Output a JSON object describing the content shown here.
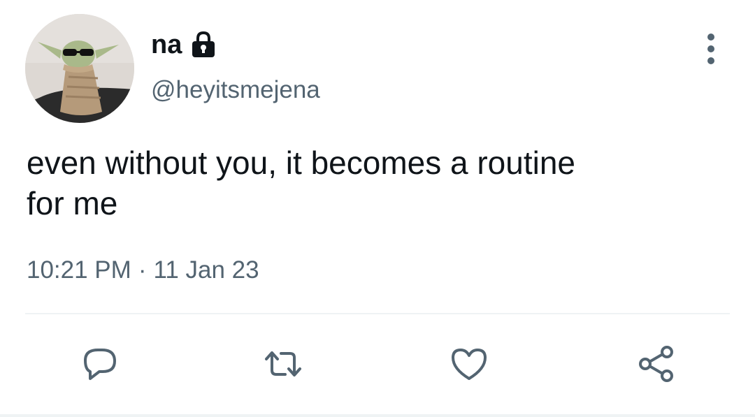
{
  "tweet": {
    "author": {
      "display_name": "na",
      "handle": "@heyitsmejena",
      "protected_icon": "lock-icon",
      "avatar_icon": "avatar-image"
    },
    "text": "even without you, it becomes a routine\nfor me",
    "time": "10:21 PM",
    "separator": "·",
    "date": "11 Jan 23"
  },
  "actions": [
    {
      "name": "reply",
      "icon": "reply-icon"
    },
    {
      "name": "retweet",
      "icon": "retweet-icon"
    },
    {
      "name": "like",
      "icon": "heart-icon"
    },
    {
      "name": "share",
      "icon": "share-icon"
    }
  ],
  "menu": {
    "icon": "more-vertical-icon"
  },
  "colors": {
    "text_primary": "#0f1419",
    "text_secondary": "#536471",
    "divider": "#eff3f4"
  }
}
